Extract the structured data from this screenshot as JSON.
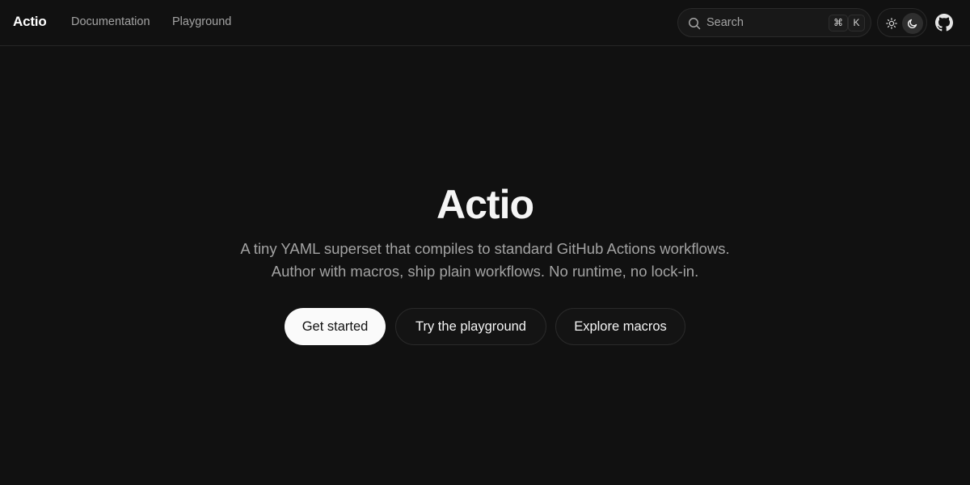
{
  "nav": {
    "logo": "Actio",
    "links": [
      {
        "label": "Documentation"
      },
      {
        "label": "Playground"
      }
    ],
    "search": {
      "placeholder": "Search",
      "shortcut_mod": "⌘",
      "shortcut_key": "K"
    },
    "theme": {
      "light_icon": "sun-icon",
      "dark_icon": "moon-icon",
      "active": "dark"
    },
    "github_icon": "github-icon"
  },
  "hero": {
    "title": "Actio",
    "subtitle_line1": "A tiny YAML superset that compiles to standard GitHub Actions workflows.",
    "subtitle_line2": "Author with macros, ship plain workflows. No runtime, no lock-in.",
    "buttons": {
      "primary": "Get started",
      "playground": "Try the playground",
      "macros": "Explore macros"
    }
  },
  "colors": {
    "background": "#111111",
    "primary_button": "#fafafa",
    "muted_text": "#a3a3a3",
    "border": "#2a2a2a"
  }
}
